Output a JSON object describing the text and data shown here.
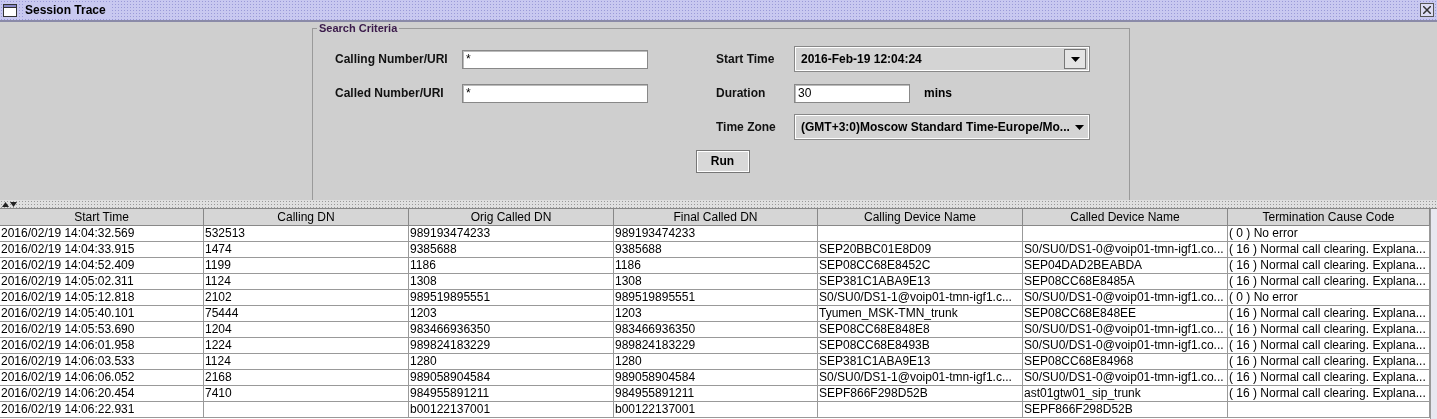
{
  "window": {
    "title": "Session Trace"
  },
  "search_criteria": {
    "title": "Search Criteria",
    "calling_number": {
      "label": "Calling Number/URI",
      "value": "*"
    },
    "called_number": {
      "label": "Called Number/URI",
      "value": "*"
    },
    "start_time": {
      "label": "Start Time",
      "value": "2016-Feb-19 12:04:24"
    },
    "duration": {
      "label": "Duration",
      "value": "30",
      "unit": "mins"
    },
    "time_zone": {
      "label": "Time Zone",
      "value": "(GMT+3:0)Moscow Standard Time-Europe/Mo..."
    },
    "run_button": "Run"
  },
  "table": {
    "columns": [
      "Start Time",
      "Calling DN",
      "Orig Called DN",
      "Final Called DN",
      "Calling Device Name",
      "Called Device Name",
      "Termination Cause Code"
    ],
    "rows": [
      [
        "2016/02/19 14:04:32.569",
        "532513",
        "989193474233",
        "989193474233",
        "",
        "",
        "( 0 ) No error"
      ],
      [
        "2016/02/19 14:04:33.915",
        "1474",
        "9385688",
        "9385688",
        "SEP20BBC01E8D09",
        "S0/SU0/DS1-0@voip01-tmn-igf1.co...",
        "( 16 ) Normal call clearing. Explana..."
      ],
      [
        "2016/02/19 14:04:52.409",
        "1199",
        "1186",
        "1186",
        "SEP08CC68E8452C",
        "SEP04DAD2BEABDA",
        "( 16 ) Normal call clearing. Explana..."
      ],
      [
        "2016/02/19 14:05:02.311",
        "1124",
        "1308",
        "1308",
        "SEP381C1ABA9E13",
        "SEP08CC68E8485A",
        "( 16 ) Normal call clearing. Explana..."
      ],
      [
        "2016/02/19 14:05:12.818",
        "2102",
        "989519895551",
        "989519895551",
        "S0/SU0/DS1-1@voip01-tmn-igf1.c...",
        "S0/SU0/DS1-0@voip01-tmn-igf1.co...",
        "( 0 ) No error"
      ],
      [
        "2016/02/19 14:05:40.101",
        "75444",
        "1203",
        "1203",
        "Tyumen_MSK-TMN_trunk",
        "SEP08CC68E848EE",
        "( 16 ) Normal call clearing. Explana..."
      ],
      [
        "2016/02/19 14:05:53.690",
        "1204",
        "983466936350",
        "983466936350",
        "SEP08CC68E848E8",
        "S0/SU0/DS1-0@voip01-tmn-igf1.co...",
        "( 16 ) Normal call clearing. Explana..."
      ],
      [
        "2016/02/19 14:06:01.958",
        "1224",
        "989824183229",
        "989824183229",
        "SEP08CC68E8493B",
        "S0/SU0/DS1-0@voip01-tmn-igf1.co...",
        "( 16 ) Normal call clearing. Explana..."
      ],
      [
        "2016/02/19 14:06:03.533",
        "1124",
        "1280",
        "1280",
        "SEP381C1ABA9E13",
        "SEP08CC68E84968",
        "( 16 ) Normal call clearing. Explana..."
      ],
      [
        "2016/02/19 14:06:06.052",
        "2168",
        "989058904584",
        "989058904584",
        "S0/SU0/DS1-1@voip01-tmn-igf1.c...",
        "S0/SU0/DS1-0@voip01-tmn-igf1.co...",
        "( 16 ) Normal call clearing. Explana..."
      ],
      [
        "2016/02/19 14:06:20.454",
        "7410",
        "984955891211",
        "984955891211",
        "SEPF866F298D52B",
        "ast01gtw01_sip_trunk",
        "( 16 ) Normal call clearing. Explana..."
      ],
      [
        "2016/02/19 14:06:22.931",
        "",
        "b00122137001",
        "b00122137001",
        "",
        "SEPF866F298D52B",
        ""
      ]
    ]
  }
}
